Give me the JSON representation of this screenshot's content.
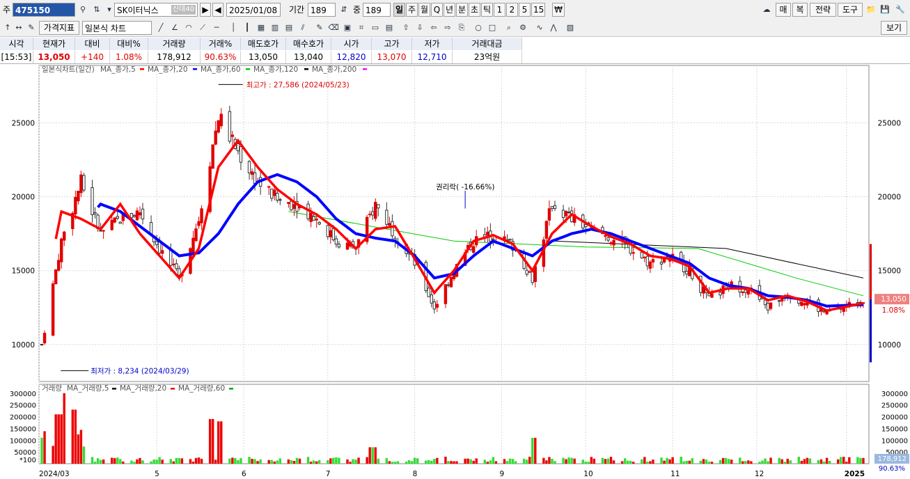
{
  "toolbar1": {
    "type_label": "주",
    "code": "475150",
    "name": "SK이터닉스",
    "name_badge": "신대40",
    "date": "2025/01/08",
    "period_label": "기간",
    "period_value": "189",
    "count_label": "중",
    "count_value": "189",
    "intervals": [
      "일",
      "주",
      "월",
      "Q",
      "년",
      "분",
      "초",
      "틱",
      "1",
      "2",
      "5",
      "15"
    ],
    "selected_interval": "일",
    "currency_icon": "₩",
    "right_buttons": [
      "매",
      "복",
      "전략",
      "도구"
    ]
  },
  "toolbar2": {
    "indicator_button": "가격지표",
    "chart_type": "일본식 차트",
    "view_button": "보기"
  },
  "quote": {
    "headers": [
      "시각",
      "현재가",
      "대비",
      "대비%",
      "거래량",
      "거래%",
      "매도호가",
      "매수호가",
      "시가",
      "고가",
      "저가",
      "거래대금"
    ],
    "values": [
      "[15:53]",
      "13,050",
      "+140",
      "1.08%",
      "178,912",
      "90.63%",
      "13,050",
      "13,040",
      "12,820",
      "13,070",
      "12,710",
      "23억원"
    ]
  },
  "chart_data": {
    "type": "candlestick",
    "price_legend": [
      "일본식차트(일간)",
      "MA_종가,5",
      "MA_종가,20",
      "MA_종가,60",
      "MA_종가,120",
      "MA_종가,200"
    ],
    "volume_legend": [
      "거래량",
      "MA_거래량,5",
      "MA_거래량,20",
      "MA_거래량,60"
    ],
    "price_axis": [
      10000,
      15000,
      20000,
      25000
    ],
    "volume_axis": [
      50000,
      100000,
      150000,
      200000,
      250000,
      300000
    ],
    "volume_unit": "*100",
    "x_labels": [
      "2024/03",
      "5",
      "6",
      "7",
      "8",
      "9",
      "10",
      "11",
      "12",
      "2025"
    ],
    "high_annotation": "최고가 : 27,586 (2024/05/23)",
    "low_annotation": "최저가 : 8,234 (2024/03/29)",
    "event_annotation": "권리락( -16.66%)",
    "last_price": "13,050",
    "last_change": "1.08%",
    "last_volume": "178,912",
    "last_volume_pct": "90.63%",
    "colors": {
      "up": "#e00000",
      "down": "#1a1aff",
      "ma5": "#ff0000",
      "ma20": "#0000ff",
      "ma60": "#00cc00",
      "ma120": "#000000"
    },
    "anchors": [
      [
        "2024-03-21",
        10000,
        12500,
        10500
      ],
      [
        "2024-03-28",
        17000,
        19000,
        15500
      ],
      [
        "2024-04-04",
        21000,
        18500,
        18000
      ],
      [
        "2024-04-11",
        17500,
        17800,
        19500
      ],
      [
        "2024-04-18",
        18500,
        19500,
        19000
      ],
      [
        "2024-04-25",
        19000,
        17500,
        18000
      ],
      [
        "2024-05-02",
        16500,
        16000,
        17000
      ],
      [
        "2024-05-09",
        14500,
        14500,
        16000
      ],
      [
        "2024-05-16",
        18500,
        16500,
        16200
      ],
      [
        "2024-05-23",
        25500,
        22000,
        17500
      ],
      [
        "2024-05-30",
        23000,
        23800,
        19500
      ],
      [
        "2024-06-06",
        21000,
        22000,
        21000
      ],
      [
        "2024-06-13",
        19800,
        20500,
        21500
      ],
      [
        "2024-06-20",
        19500,
        19500,
        21000
      ],
      [
        "2024-06-27",
        18500,
        18800,
        20000
      ],
      [
        "2024-07-04",
        17000,
        17800,
        18500
      ],
      [
        "2024-07-11",
        16500,
        16500,
        17500
      ],
      [
        "2024-07-18",
        19500,
        17800,
        17200
      ],
      [
        "2024-07-25",
        17500,
        18000,
        17000
      ],
      [
        "2024-08-01",
        15500,
        15800,
        16000
      ],
      [
        "2024-08-08",
        12500,
        13500,
        14500
      ],
      [
        "2024-08-15",
        15000,
        15000,
        14800
      ],
      [
        "2024-08-22",
        17000,
        17000,
        16000
      ],
      [
        "2024-08-29",
        17400,
        17400,
        17000
      ],
      [
        "2024-09-05",
        16700,
        16800,
        16500
      ],
      [
        "2024-09-12",
        14500,
        15000,
        16000
      ],
      [
        "2024-09-19",
        19500,
        17500,
        17000
      ],
      [
        "2024-09-26",
        18500,
        18800,
        17500
      ],
      [
        "2024-10-03",
        17800,
        18000,
        17800
      ],
      [
        "2024-10-10",
        17200,
        17300,
        17500
      ],
      [
        "2024-10-17",
        16500,
        16800,
        17000
      ],
      [
        "2024-10-24",
        15500,
        16000,
        16500
      ],
      [
        "2024-10-31",
        16000,
        15800,
        16000
      ],
      [
        "2024-11-07",
        15000,
        15300,
        15500
      ],
      [
        "2024-11-14",
        13000,
        13500,
        14500
      ],
      [
        "2024-11-21",
        14000,
        13800,
        14000
      ],
      [
        "2024-11-28",
        13800,
        13800,
        13800
      ],
      [
        "2024-12-05",
        12500,
        13000,
        13300
      ],
      [
        "2024-12-12",
        13500,
        13300,
        13200
      ],
      [
        "2024-12-19",
        12800,
        12900,
        13000
      ],
      [
        "2024-12-26",
        12100,
        12300,
        12600
      ],
      [
        "2025-01-08",
        13050,
        12800,
        12700
      ]
    ],
    "ma60_range": [
      "2024-06-17",
      "2025-01-08"
    ],
    "ma60_points": [
      [
        19000,
        "2024-06-17"
      ],
      [
        17000,
        "2024-08-15"
      ],
      [
        16600,
        "2024-10-01"
      ],
      [
        16500,
        "2024-11-10"
      ],
      [
        14500,
        "2024-12-15"
      ],
      [
        13300,
        "2025-01-08"
      ]
    ],
    "ma120_points": [
      [
        17000,
        "2024-09-20"
      ],
      [
        16500,
        "2024-11-20"
      ],
      [
        14500,
        "2025-01-08"
      ]
    ],
    "volume_peaks": [
      [
        "2024-03-29",
        300000
      ],
      [
        "2024-03-27",
        210000
      ],
      [
        "2024-04-01",
        230000
      ],
      [
        "2024-05-20",
        190000
      ],
      [
        "2024-05-24",
        180000
      ],
      [
        "2024-07-17",
        70000
      ],
      [
        "2024-09-13",
        110000
      ]
    ]
  }
}
